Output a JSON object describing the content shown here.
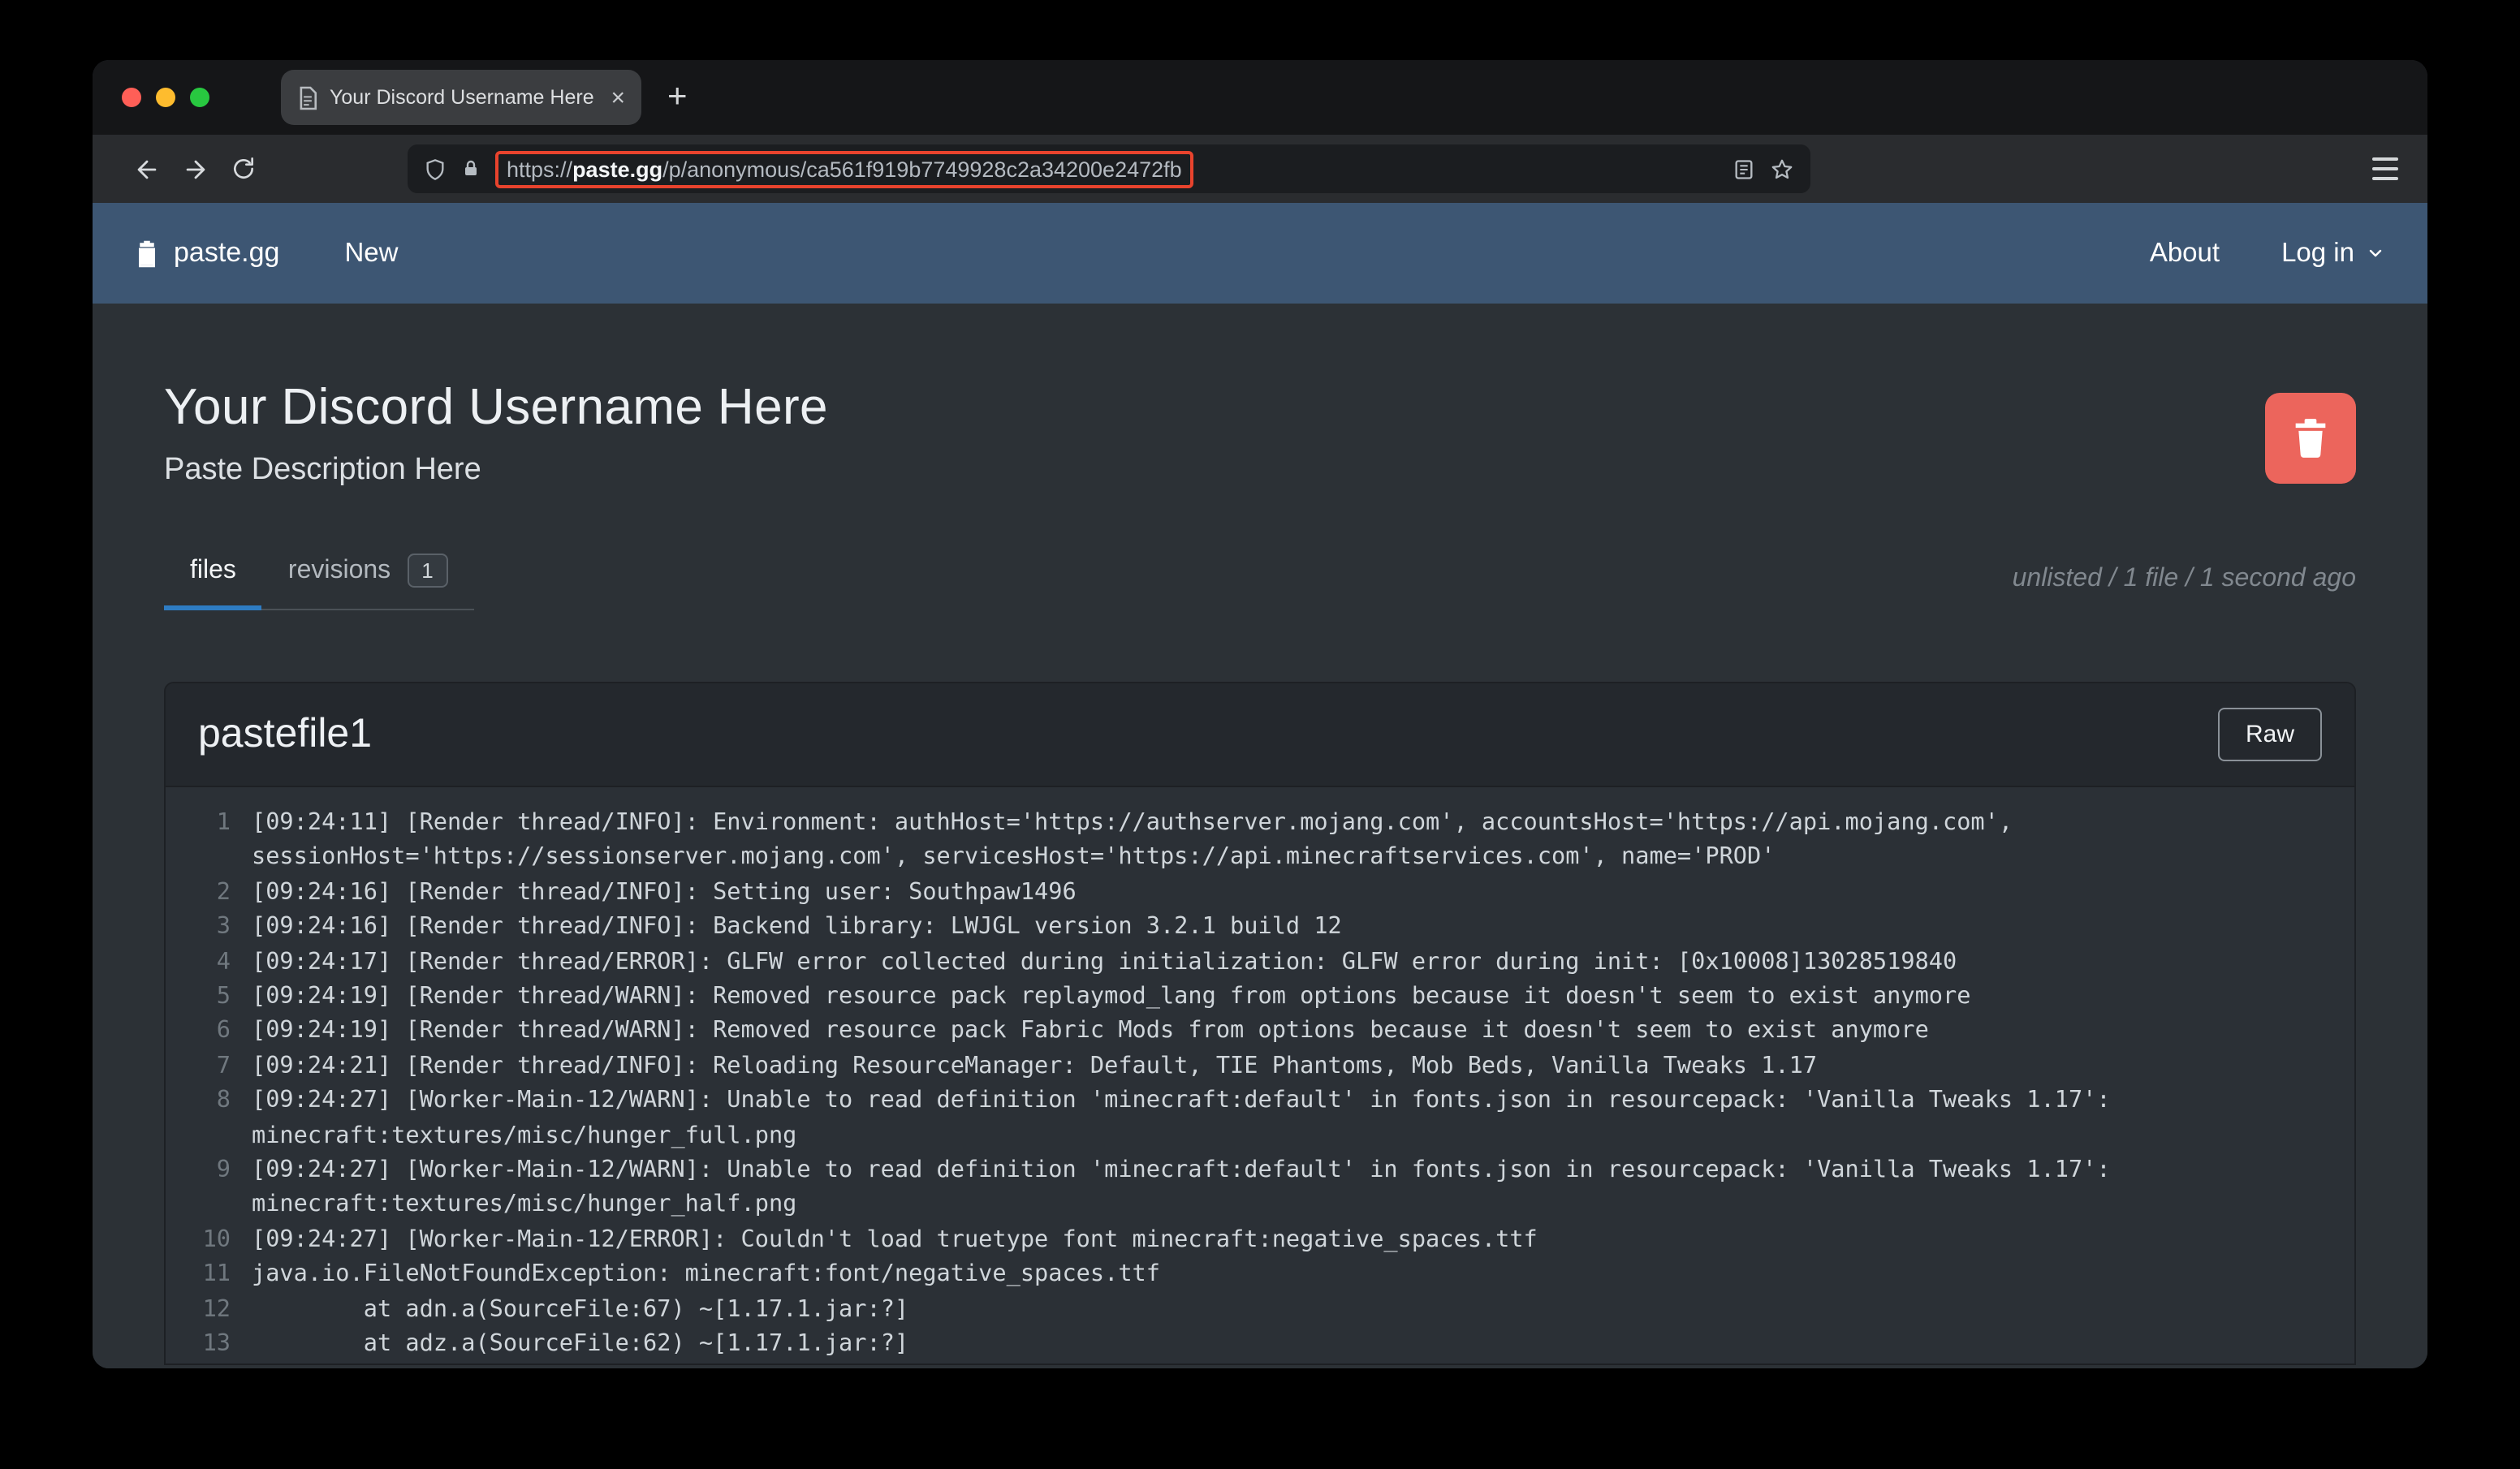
{
  "browser": {
    "tab_title": "Your Discord Username Here · p",
    "tab_close": "×",
    "new_tab": "+",
    "url_scheme": "https://",
    "url_domain": "paste.gg",
    "url_path": "/p/anonymous/ca561f919b7749928c2a34200e2472fb",
    "annotation_color": "#e8432d"
  },
  "site_nav": {
    "brand": "paste.gg",
    "new_link": "New",
    "about_link": "About",
    "login_link": "Log in"
  },
  "paste": {
    "title": "Your Discord Username Here",
    "description": "Paste Description Here",
    "tab_files": "files",
    "tab_revisions": "revisions",
    "revisions_count": "1",
    "meta": "unlisted / 1 file / 1 second ago"
  },
  "file": {
    "name": "pastefile1",
    "raw_label": "Raw"
  },
  "colors": {
    "accent_blue": "#2e7cc3",
    "delete_red": "#ec655c",
    "navbar_blue": "#3d5673"
  },
  "code": {
    "lines": [
      {
        "n": "1",
        "t": "[09:24:11] [Render thread/INFO]: Environment: authHost='https://authserver.mojang.com', accountsHost='https://api.mojang.com', sessionHost='https://sessionserver.mojang.com', servicesHost='https://api.minecraftservices.com', name='PROD'"
      },
      {
        "n": "2",
        "t": "[09:24:16] [Render thread/INFO]: Setting user: Southpaw1496"
      },
      {
        "n": "3",
        "t": "[09:24:16] [Render thread/INFO]: Backend library: LWJGL version 3.2.1 build 12"
      },
      {
        "n": "4",
        "t": "[09:24:17] [Render thread/ERROR]: GLFW error collected during initialization: GLFW error during init: [0x10008]13028519840"
      },
      {
        "n": "5",
        "t": "[09:24:19] [Render thread/WARN]: Removed resource pack replaymod_lang from options because it doesn't seem to exist anymore"
      },
      {
        "n": "6",
        "t": "[09:24:19] [Render thread/WARN]: Removed resource pack Fabric Mods from options because it doesn't seem to exist anymore"
      },
      {
        "n": "7",
        "t": "[09:24:21] [Render thread/INFO]: Reloading ResourceManager: Default, TIE Phantoms, Mob Beds, Vanilla Tweaks 1.17"
      },
      {
        "n": "8",
        "t": "[09:24:27] [Worker-Main-12/WARN]: Unable to read definition 'minecraft:default' in fonts.json in resourcepack: 'Vanilla Tweaks 1.17': minecraft:textures/misc/hunger_full.png"
      },
      {
        "n": "9",
        "t": "[09:24:27] [Worker-Main-12/WARN]: Unable to read definition 'minecraft:default' in fonts.json in resourcepack: 'Vanilla Tweaks 1.17': minecraft:textures/misc/hunger_half.png"
      },
      {
        "n": "10",
        "t": "[09:24:27] [Worker-Main-12/ERROR]: Couldn't load truetype font minecraft:negative_spaces.ttf"
      },
      {
        "n": "11",
        "t": "java.io.FileNotFoundException: minecraft:font/negative_spaces.ttf"
      },
      {
        "n": "12",
        "t": "        at adn.a(SourceFile:67) ~[1.17.1.jar:?]"
      },
      {
        "n": "13",
        "t": "        at adz.a(SourceFile:62) ~[1.17.1.jar:?]"
      }
    ]
  }
}
